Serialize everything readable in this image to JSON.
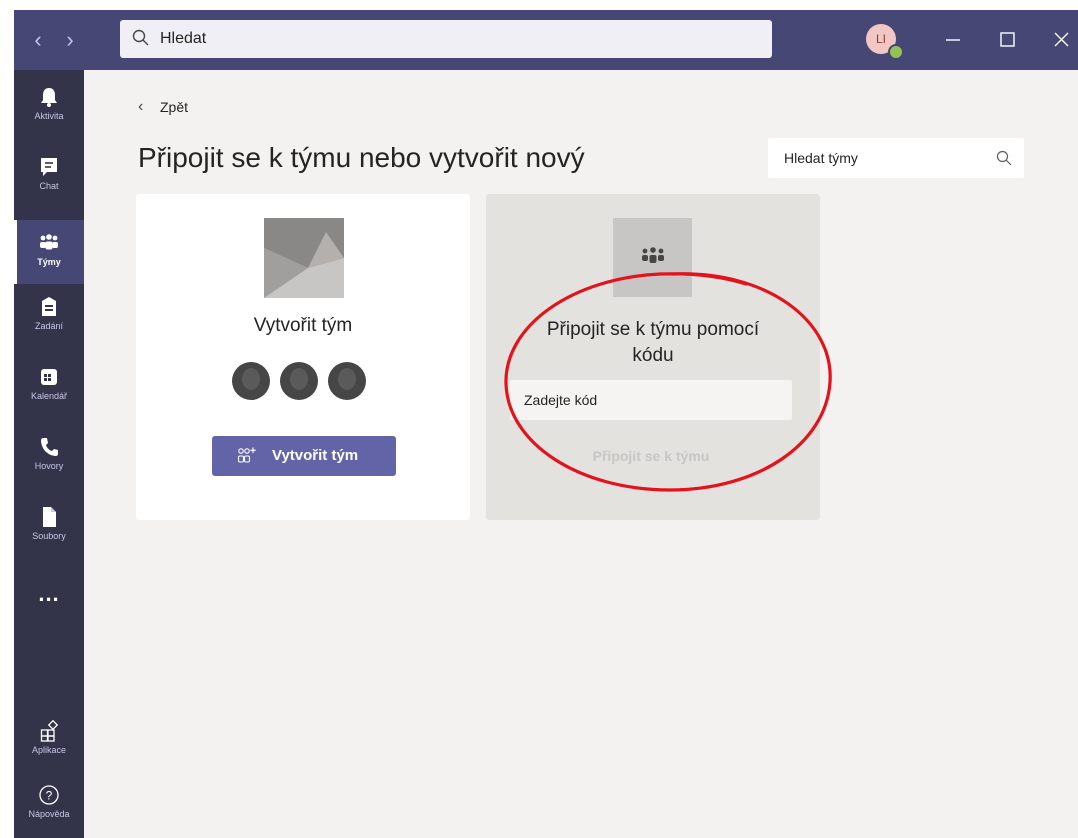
{
  "titlebar": {
    "search_text": "Hledat",
    "avatar_initials": "LI",
    "presence_color": "#92c353",
    "accent_color": "#464775"
  },
  "rail": {
    "items": [
      {
        "label": "Aktivita",
        "icon": "bell-icon"
      },
      {
        "label": "Chat",
        "icon": "chat-icon"
      },
      {
        "label": "Týmy",
        "icon": "teams-icon",
        "active": true
      },
      {
        "label": "Zadání",
        "icon": "assignments-icon"
      },
      {
        "label": "Kalendář",
        "icon": "calendar-icon"
      },
      {
        "label": "Hovory",
        "icon": "phone-icon"
      },
      {
        "label": "Soubory",
        "icon": "file-icon"
      },
      {
        "label": "...",
        "icon": "more-icon"
      },
      {
        "label": "Aplikace",
        "icon": "apps-icon"
      },
      {
        "label": "Nápověda",
        "icon": "help-icon"
      }
    ]
  },
  "main": {
    "back_label": "Zpět",
    "title": "Připojit se k týmu nebo vytvořit nový",
    "team_search_placeholder": "Hledat týmy"
  },
  "create_card": {
    "title": "Vytvořit tým",
    "button_label": "Vytvořit tým"
  },
  "join_card": {
    "title_line1": "Připojit se k týmu pomocí",
    "title_line2": "kódu",
    "code_placeholder": "Zadejte kód",
    "button_label": "Připojit se k týmu"
  },
  "annotation": {
    "color": "#e3121b"
  }
}
